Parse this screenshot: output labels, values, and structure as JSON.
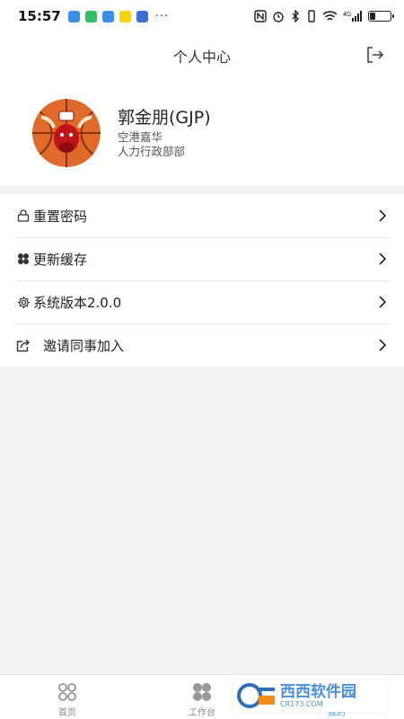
{
  "status_bar": {
    "time": "15:57",
    "dots": "···",
    "notification_colors": [
      "#3a8ee6",
      "#2fbf62",
      "#3a8ee6",
      "#f5d400",
      "#3a6fd8"
    ],
    "signal_label": "4G"
  },
  "header": {
    "title": "个人中心",
    "logout_icon": "logout-icon"
  },
  "profile": {
    "name": "郭金朋(GJP)",
    "company": "空港嘉华",
    "department": "人力行政部部"
  },
  "menu": {
    "items": [
      {
        "label": "重置密码",
        "icon": "lock-icon"
      },
      {
        "label": "更新缓存",
        "icon": "clover-icon"
      },
      {
        "label": "系统版本2.0.0",
        "icon": "gear-icon"
      },
      {
        "label": "邀请同事加入",
        "icon": "share-icon"
      }
    ]
  },
  "tabbar": {
    "tabs": [
      {
        "label": "首页",
        "icon": "home-grid-icon",
        "active": false
      },
      {
        "label": "工作台",
        "icon": "workbench-icon",
        "active": false
      },
      {
        "label": "我的",
        "icon": "profile-icon",
        "active": true
      }
    ]
  },
  "watermark": {
    "line1": "西西软件园",
    "line2": "CR173.COM"
  },
  "colors": {
    "accent": "#4aa3f0",
    "background": "#f2f2f2",
    "divider": "#e6e6e6"
  }
}
